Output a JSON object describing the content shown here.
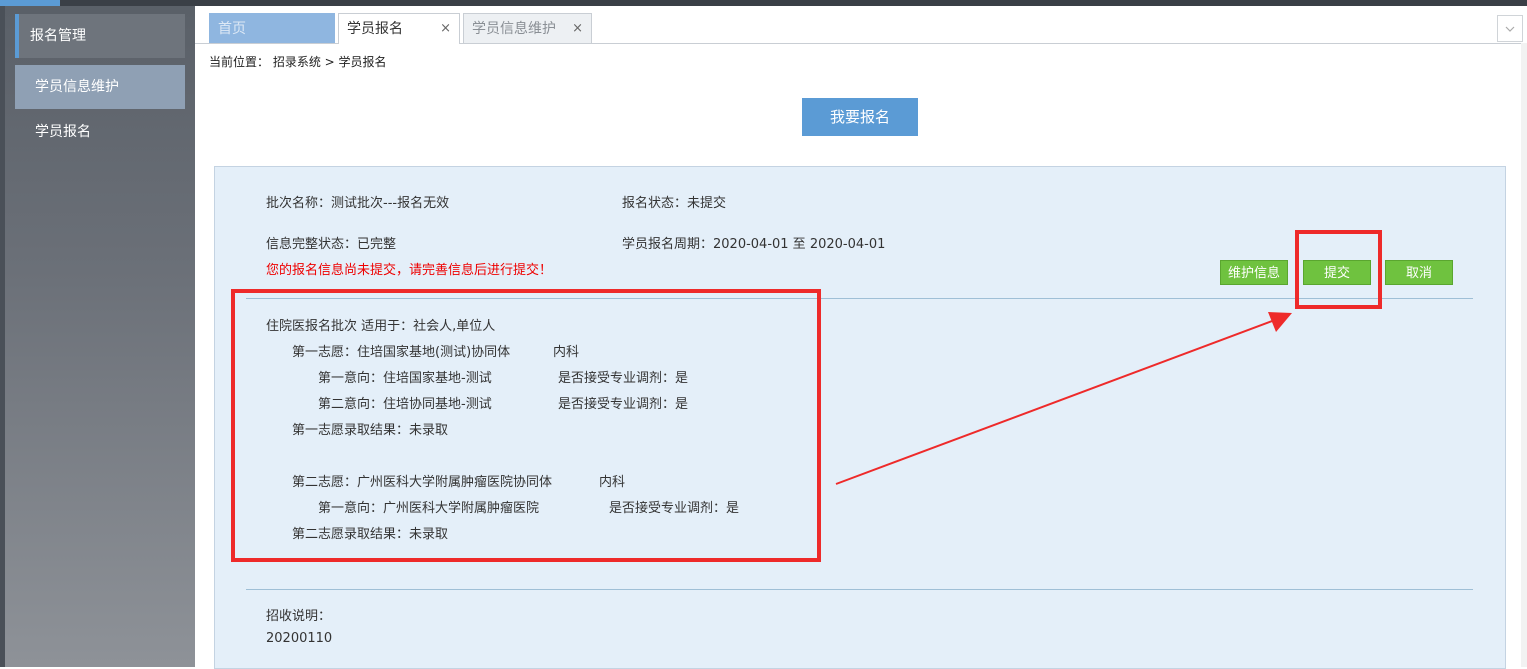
{
  "sidebar": {
    "group_label": "报名管理",
    "items": [
      {
        "label": "学员信息维护"
      },
      {
        "label": "学员报名"
      }
    ]
  },
  "tabs": [
    {
      "label": "首页"
    },
    {
      "label": "学员报名",
      "close": "×"
    },
    {
      "label": "学员信息维护",
      "close": "×"
    }
  ],
  "tab_menu_icon": "chevron-down-icon",
  "breadcrumb": "当前位置： 招录系统 > 学员报名",
  "apply_button": "我要报名",
  "batch": {
    "name": "批次名称：测试批次---报名无效",
    "status": "报名状态：未提交",
    "info_status": "信息完整状态：已完整",
    "period": "学员报名周期：2020-04-01 至 2020-04-01",
    "warning": "您的报名信息尚未提交，请完善信息后进行提交！",
    "buttons": {
      "maintain": "维护信息",
      "submit": "提交",
      "cancel": "取消"
    }
  },
  "choices": {
    "header": "住院医报名批次 适用于：社会人,单位人",
    "first": {
      "title": "第一志愿：住培国家基地(测试)协同体",
      "dept": "内科",
      "intents": [
        {
          "label": "第一意向：住培国家基地-测试",
          "adjust": "是否接受专业调剂：是"
        },
        {
          "label": "第二意向：住培协同基地-测试",
          "adjust": "是否接受专业调剂：是"
        }
      ],
      "result": "第一志愿录取结果：未录取"
    },
    "second": {
      "title": "第二志愿：广州医科大学附属肿瘤医院协同体",
      "dept": "内科",
      "intents": [
        {
          "label": "第一意向：广州医科大学附属肿瘤医院",
          "adjust": "是否接受专业调剂：是"
        }
      ],
      "result": "第二志愿录取结果：未录取"
    }
  },
  "notes": {
    "label": "招收说明：",
    "value": "20200110"
  },
  "colors": {
    "accent": "#5b9bd5",
    "button_green": "#6fc23f",
    "warning_red": "#ee0000",
    "annotation_red": "#ee2a2a",
    "panel_bg": "#e4eff9"
  }
}
